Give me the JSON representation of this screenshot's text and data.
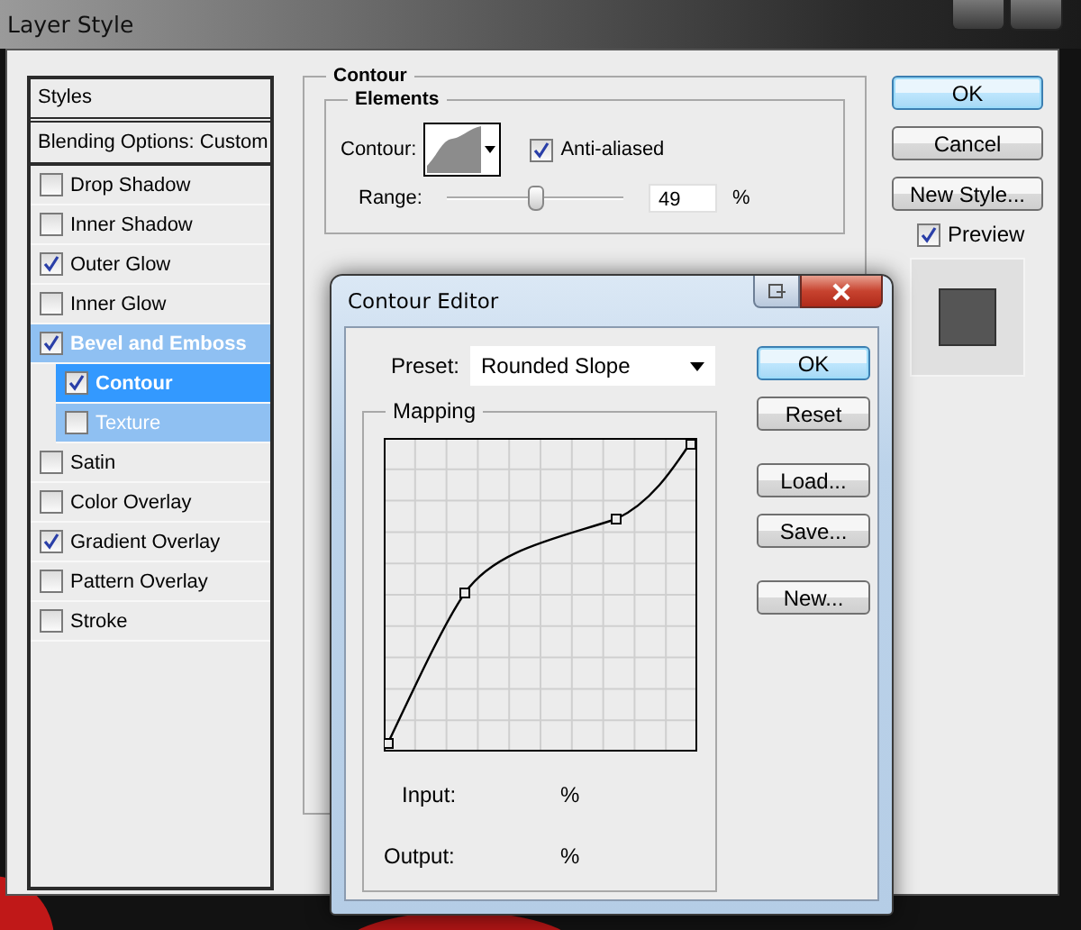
{
  "window": {
    "title": "Layer Style"
  },
  "styles_panel": {
    "header": "Styles",
    "blending_options": "Blending Options: Custom",
    "items": [
      {
        "label": "Drop Shadow",
        "checked": false,
        "selected": false
      },
      {
        "label": "Inner Shadow",
        "checked": false,
        "selected": false
      },
      {
        "label": "Outer Glow",
        "checked": true,
        "selected": false
      },
      {
        "label": "Inner Glow",
        "checked": false,
        "selected": false
      },
      {
        "label": "Bevel and Emboss",
        "checked": true,
        "selected": false,
        "children": [
          {
            "label": "Contour",
            "checked": true,
            "selected": true
          },
          {
            "label": "Texture",
            "checked": false,
            "selected": false
          }
        ]
      },
      {
        "label": "Satin",
        "checked": false,
        "selected": false
      },
      {
        "label": "Color Overlay",
        "checked": false,
        "selected": false
      },
      {
        "label": "Gradient Overlay",
        "checked": true,
        "selected": false
      },
      {
        "label": "Pattern Overlay",
        "checked": false,
        "selected": false
      },
      {
        "label": "Stroke",
        "checked": false,
        "selected": false
      }
    ]
  },
  "contour_group": {
    "title": "Contour",
    "elements": {
      "title": "Elements",
      "contour_label": "Contour:",
      "anti_aliased": {
        "label": "Anti-aliased",
        "checked": true
      },
      "range": {
        "label": "Range:",
        "level": 0.49,
        "value": "49",
        "unit": "%"
      }
    }
  },
  "buttons": [
    {
      "label": "OK",
      "default": true
    },
    {
      "label": "Cancel",
      "default": false
    },
    {
      "label": "New Style...",
      "default": false
    }
  ],
  "preview": {
    "label": "Preview",
    "checked": true
  },
  "contour_editor": {
    "title": "Contour Editor",
    "preset_label": "Preset:",
    "preset_value": "Rounded Slope",
    "mapping_title": "Mapping",
    "input_label": "Input:",
    "input_unit": "%",
    "output_label": "Output:",
    "output_unit": "%",
    "buttons": [
      {
        "label": "OK",
        "default": true
      },
      {
        "label": "Reset",
        "default": false
      },
      {
        "label": "Load...",
        "default": false
      },
      {
        "label": "Save...",
        "default": false
      },
      {
        "label": "New...",
        "default": false
      }
    ]
  }
}
